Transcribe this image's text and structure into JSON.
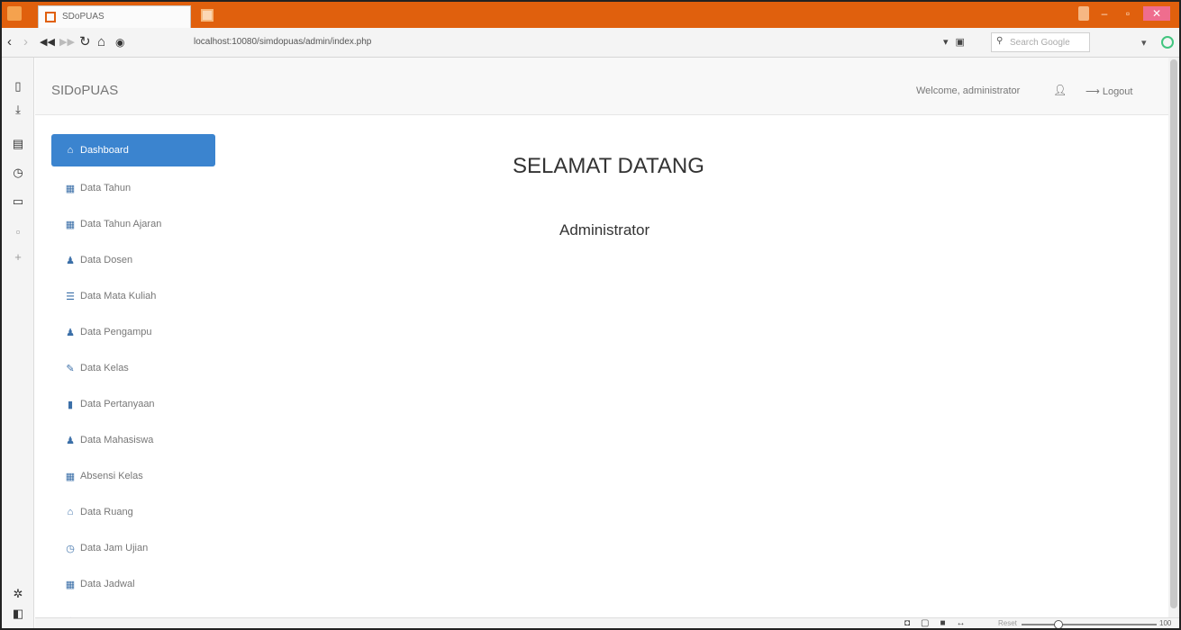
{
  "browser": {
    "tab_title": "SDoPUAS",
    "address": "localhost:10080/simdopuas/admin/index.php",
    "search_placeholder": "Search Google",
    "zoom_label": "Reset",
    "zoom_percent": "100 %"
  },
  "topbar": {
    "brand": "SIDoPUAS",
    "welcome": "Welcome, administrator",
    "logout": "Logout"
  },
  "main": {
    "heading": "SELAMAT DATANG",
    "subheading": "Administrator"
  },
  "menu": [
    {
      "label": "Dashboard",
      "icon": "home-icon",
      "active": true
    },
    {
      "label": "Data Tahun",
      "icon": "table-icon"
    },
    {
      "label": "Data Tahun Ajaran",
      "icon": "table-icon"
    },
    {
      "label": "Data Dosen",
      "icon": "user-icon"
    },
    {
      "label": "Data Mata Kuliah",
      "icon": "list-icon"
    },
    {
      "label": "Data Pengampu",
      "icon": "user-icon"
    },
    {
      "label": "Data Kelas",
      "icon": "pencil-icon"
    },
    {
      "label": "Data Pertanyaan",
      "icon": "book-icon"
    },
    {
      "label": "Data Mahasiswa",
      "icon": "user-icon"
    },
    {
      "label": "Absensi Kelas",
      "icon": "table-icon"
    },
    {
      "label": "Data Ruang",
      "icon": "home-icon"
    },
    {
      "label": "Data Jam Ujian",
      "icon": "clock-icon"
    },
    {
      "label": "Data Jadwal",
      "icon": "table-icon"
    },
    {
      "label": "",
      "icon": "home-icon"
    }
  ]
}
